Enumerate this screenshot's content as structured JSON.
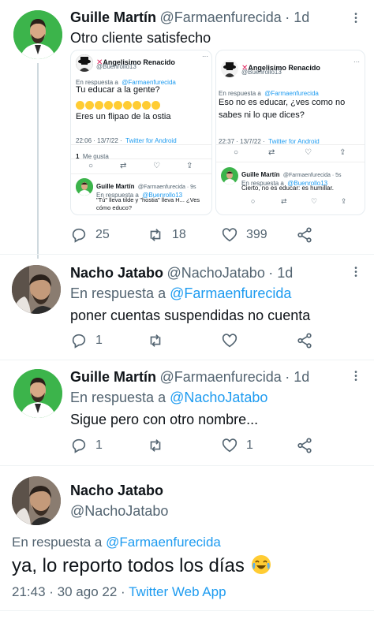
{
  "tweet1": {
    "name": "Guille Martín",
    "handle": "@Farmaenfurecida",
    "time": "· 1d",
    "text": "Otro cliente satisfecho",
    "replies": "25",
    "retweets": "18",
    "likes": "399",
    "embedded": {
      "left": {
        "name": "Angelisimo Renacido",
        "handle": "@Buenrollo13",
        "reply_to_prefix": "En respuesta a",
        "reply_to": "@Farmaenfurecida",
        "line1": "Tu educar a la gente?",
        "emoji_count": 9,
        "line2": "Eres un flipao de la ostia",
        "meta_time": "22:06 · 13/7/22 ·",
        "meta_app": "Twitter for Android",
        "likes_count": "1",
        "likes_label": "Me gusta",
        "reply_name": "Guille Martín",
        "reply_handle": "@Farmaenfurecida · 9s",
        "reply_prefix": "En respuesta a",
        "reply_to2": "@Buenrollo13",
        "reply_text1": "\"Tú\" lleva tilde y \"hostia\" lleva H... ¿Ves",
        "reply_text2": "cómo educo?"
      },
      "right": {
        "name": "Angelisimo Renacido",
        "handle": "@Buenrollo13",
        "reply_to_prefix": "En respuesta a",
        "reply_to": "@Farmaenfurecida",
        "line1": "Eso no es educar, ¿ves como no",
        "line2": "sabes ni lo que dices?",
        "meta_time": "22:37 · 13/7/22 ·",
        "meta_app": "Twitter for Android",
        "reply_name": "Guille Martín",
        "reply_handle": "@Farmaenfurecida · 5s",
        "reply_prefix": "En respuesta a",
        "reply_to2": "@Buenrollo13",
        "reply_text": "Cierto, no es educar: es humillar."
      }
    }
  },
  "tweet2": {
    "name": "Nacho Jatabo",
    "handle": "@NachoJatabo",
    "time": "· 1d",
    "reply_prefix": "En respuesta a",
    "reply_to": "@Farmaenfurecida",
    "text": "poner cuentas suspendidas no cuenta",
    "replies": "1"
  },
  "tweet3": {
    "name": "Guille Martín",
    "handle": "@Farmaenfurecida",
    "time": "· 1d",
    "reply_prefix": "En respuesta a",
    "reply_to": "@NachoJatabo",
    "text": "Sigue pero con otro nombre...",
    "replies": "1",
    "likes": "1"
  },
  "tweet4": {
    "name": "Nacho Jatabo",
    "handle": "@NachoJatabo",
    "reply_prefix": "En respuesta a",
    "reply_to": "@Farmaenfurecida",
    "text": "ya, lo reporto todos los días",
    "time": "21:43 · 30 ago 22 ·",
    "app": "Twitter Web App"
  },
  "colors": {
    "accent": "#1d9bf0",
    "muted": "#536471",
    "text": "#0f1419",
    "error_red": "#e0245e"
  },
  "icons": [
    "reply-icon",
    "retweet-icon",
    "like-icon",
    "share-icon",
    "more-icon",
    "cry-laugh-emoji-icon"
  ]
}
